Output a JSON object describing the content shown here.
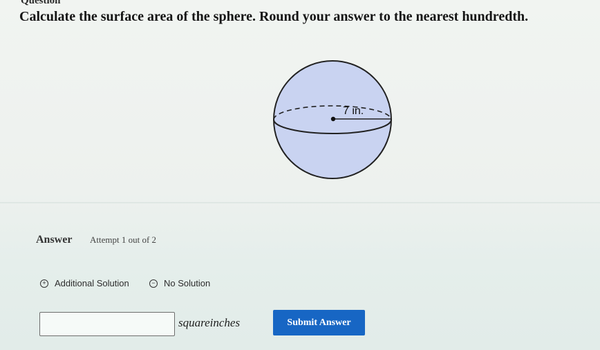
{
  "header": {
    "title": "Question"
  },
  "question": {
    "text": "Calculate the surface area of the sphere. Round your answer to the nearest hundredth."
  },
  "figure": {
    "radius_label": "7 in."
  },
  "answer": {
    "label": "Answer",
    "attempt": "Attempt 1 out of 2",
    "options": [
      {
        "icon": "plus-circle-icon",
        "glyph": "+",
        "label": "Additional Solution"
      },
      {
        "icon": "minus-circle-icon",
        "glyph": "−",
        "label": "No Solution"
      }
    ],
    "input_value": "",
    "unit": "squareinches",
    "submit_label": "Submit Answer"
  },
  "colors": {
    "sphere_fill": "#c9d3f1",
    "submit_button": "#1766c4"
  }
}
